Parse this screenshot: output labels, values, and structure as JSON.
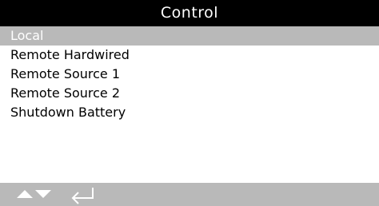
{
  "header": {
    "title": "Control"
  },
  "menu": {
    "items": [
      {
        "label": "Local",
        "selected": true
      },
      {
        "label": "Remote Hardwired",
        "selected": false
      },
      {
        "label": "Remote Source 1",
        "selected": false
      },
      {
        "label": "Remote Source 2",
        "selected": false
      },
      {
        "label": "Shutdown Battery",
        "selected": false
      }
    ]
  },
  "footer": {
    "icons": [
      "arrow-up-icon",
      "arrow-down-icon",
      "enter-return-icon"
    ]
  },
  "colors": {
    "header_bg": "#000000",
    "header_text": "#ffffff",
    "selection_bg": "#b9b9b9",
    "footer_bg": "#b9b9b9",
    "body_bg": "#ffffff",
    "text": "#000000"
  }
}
